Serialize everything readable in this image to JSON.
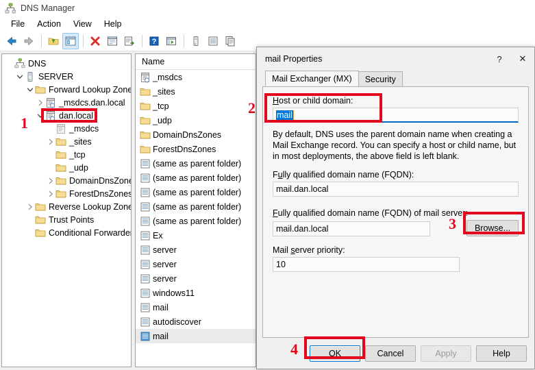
{
  "window": {
    "title": "DNS Manager",
    "icon": "dns-server-icon",
    "menu": [
      "File",
      "Action",
      "View",
      "Help"
    ],
    "toolbar": [
      {
        "name": "back-icon"
      },
      {
        "name": "forward-icon"
      },
      {
        "name": "separator"
      },
      {
        "name": "up-folder-icon"
      },
      {
        "name": "show-hide-console-tree-icon",
        "active": true
      },
      {
        "name": "separator"
      },
      {
        "name": "delete-icon"
      },
      {
        "name": "properties-icon"
      },
      {
        "name": "export-list-icon"
      },
      {
        "name": "separator"
      },
      {
        "name": "help-icon"
      },
      {
        "name": "refresh-icon"
      },
      {
        "name": "separator"
      },
      {
        "name": "server-icon"
      },
      {
        "name": "list-icon"
      },
      {
        "name": "copy-icon"
      }
    ]
  },
  "tree": {
    "nodes": [
      {
        "label": "DNS",
        "indent": 0,
        "twist": "none",
        "icon": "dns-root-icon"
      },
      {
        "label": "SERVER",
        "indent": 1,
        "twist": "expanded",
        "icon": "server-icon"
      },
      {
        "label": "Forward Lookup Zones",
        "indent": 2,
        "twist": "expanded",
        "icon": "folder-icon"
      },
      {
        "label": "_msdcs.dan.local",
        "indent": 3,
        "twist": "collapsed",
        "icon": "zone-icon"
      },
      {
        "label": "dan.local",
        "indent": 3,
        "twist": "expanded",
        "icon": "zone-icon",
        "highlighted": true
      },
      {
        "label": "_msdcs",
        "indent": 4,
        "twist": "none",
        "icon": "zone-gray-icon"
      },
      {
        "label": "_sites",
        "indent": 4,
        "twist": "collapsed",
        "icon": "folder-icon"
      },
      {
        "label": "_tcp",
        "indent": 4,
        "twist": "none",
        "icon": "folder-icon"
      },
      {
        "label": "_udp",
        "indent": 4,
        "twist": "none",
        "icon": "folder-icon"
      },
      {
        "label": "DomainDnsZones",
        "indent": 4,
        "twist": "collapsed",
        "icon": "folder-icon"
      },
      {
        "label": "ForestDnsZones",
        "indent": 4,
        "twist": "collapsed",
        "icon": "folder-icon"
      },
      {
        "label": "Reverse Lookup Zones",
        "indent": 2,
        "twist": "collapsed",
        "icon": "folder-icon"
      },
      {
        "label": "Trust Points",
        "indent": 2,
        "twist": "none",
        "icon": "folder-icon"
      },
      {
        "label": "Conditional Forwarders",
        "indent": 2,
        "twist": "none",
        "icon": "folder-icon"
      }
    ]
  },
  "list": {
    "column_header": "Name",
    "rows": [
      {
        "name": "_msdcs",
        "icon": "zone-icon"
      },
      {
        "name": "_sites",
        "icon": "folder-icon"
      },
      {
        "name": "_tcp",
        "icon": "folder-icon"
      },
      {
        "name": "_udp",
        "icon": "folder-icon"
      },
      {
        "name": "DomainDnsZones",
        "icon": "folder-icon"
      },
      {
        "name": "ForestDnsZones",
        "icon": "folder-icon"
      },
      {
        "name": "(same as parent folder)",
        "icon": "record-icon"
      },
      {
        "name": "(same as parent folder)",
        "icon": "record-icon"
      },
      {
        "name": "(same as parent folder)",
        "icon": "record-icon"
      },
      {
        "name": "(same as parent folder)",
        "icon": "record-icon"
      },
      {
        "name": "(same as parent folder)",
        "icon": "record-icon"
      },
      {
        "name": "Ex",
        "icon": "record-icon"
      },
      {
        "name": "server",
        "icon": "record-icon"
      },
      {
        "name": "server",
        "icon": "record-icon"
      },
      {
        "name": "server",
        "icon": "record-icon"
      },
      {
        "name": "windows11",
        "icon": "record-icon"
      },
      {
        "name": "mail",
        "icon": "record-icon"
      },
      {
        "name": "autodiscover",
        "icon": "record-icon"
      },
      {
        "name": "mail",
        "icon": "record-selected-icon",
        "selected": true
      }
    ]
  },
  "dialog": {
    "title": "mail Properties",
    "help_button": "?",
    "close_button": "✕",
    "tabs": [
      {
        "label": "Mail Exchanger (MX)",
        "active": true
      },
      {
        "label": "Security",
        "active": false
      }
    ],
    "host_label": "Host or child domain:",
    "host_label_mnemonic": "H",
    "host_value": "mail",
    "description": "By default, DNS uses the parent domain name when creating a Mail Exchange record. You can specify a host or child name, but in most deployments, the above field is left blank.",
    "fqdn_label": "Fully qualified domain name (FQDN):",
    "fqdn_value": "mail.dan.local",
    "mailserver_label": "Fully qualified domain name (FQDN) of mail server:",
    "mailserver_value": "mail.dan.local",
    "browse_label": "Browse...",
    "priority_label": "Mail server priority:",
    "priority_value": "10",
    "buttons": {
      "ok": "OK",
      "cancel": "Cancel",
      "apply": "Apply",
      "help": "Help"
    }
  },
  "annotations": {
    "step1": "1",
    "step2": "2",
    "step3": "3",
    "step4": "4",
    "color": "#e3071d"
  },
  "colors": {
    "accent": "#0078d7",
    "selection": "#0078d7",
    "annotation_red": "#e3071d",
    "dialog_bg": "#f0f0f0",
    "tab_body_bg": "#f6f6f6"
  }
}
